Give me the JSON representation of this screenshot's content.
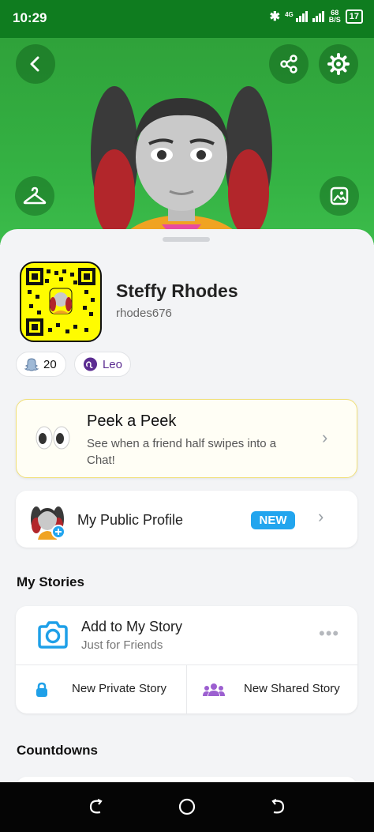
{
  "status_bar": {
    "time": "10:29",
    "network_label": "4G",
    "speed_value": "68",
    "speed_unit": "B/S",
    "battery": "17"
  },
  "header": {
    "background_color": "#35b344",
    "icons": [
      "back-arrow-icon",
      "share-icon",
      "settings-gear-icon",
      "hanger-icon",
      "photo-icon"
    ]
  },
  "profile": {
    "display_name": "Steffy Rhodes",
    "username": "rhodes676",
    "snapcode_color": "#fffc00"
  },
  "chips": {
    "friends_count": "20",
    "zodiac": "Leo"
  },
  "peek": {
    "title": "Peek a Peek",
    "description": "See when a friend half swipes into a Chat!",
    "icon": "eyes-icon"
  },
  "public_profile": {
    "label": "My Public Profile",
    "badge": "NEW",
    "badge_color": "#22a5ee"
  },
  "my_stories": {
    "section_title": "My Stories",
    "add_title": "Add to My Story",
    "add_subtitle": "Just for Friends",
    "private_label": "New Private Story",
    "shared_label": "New Shared Story"
  },
  "countdowns": {
    "section_title": "Countdowns"
  }
}
